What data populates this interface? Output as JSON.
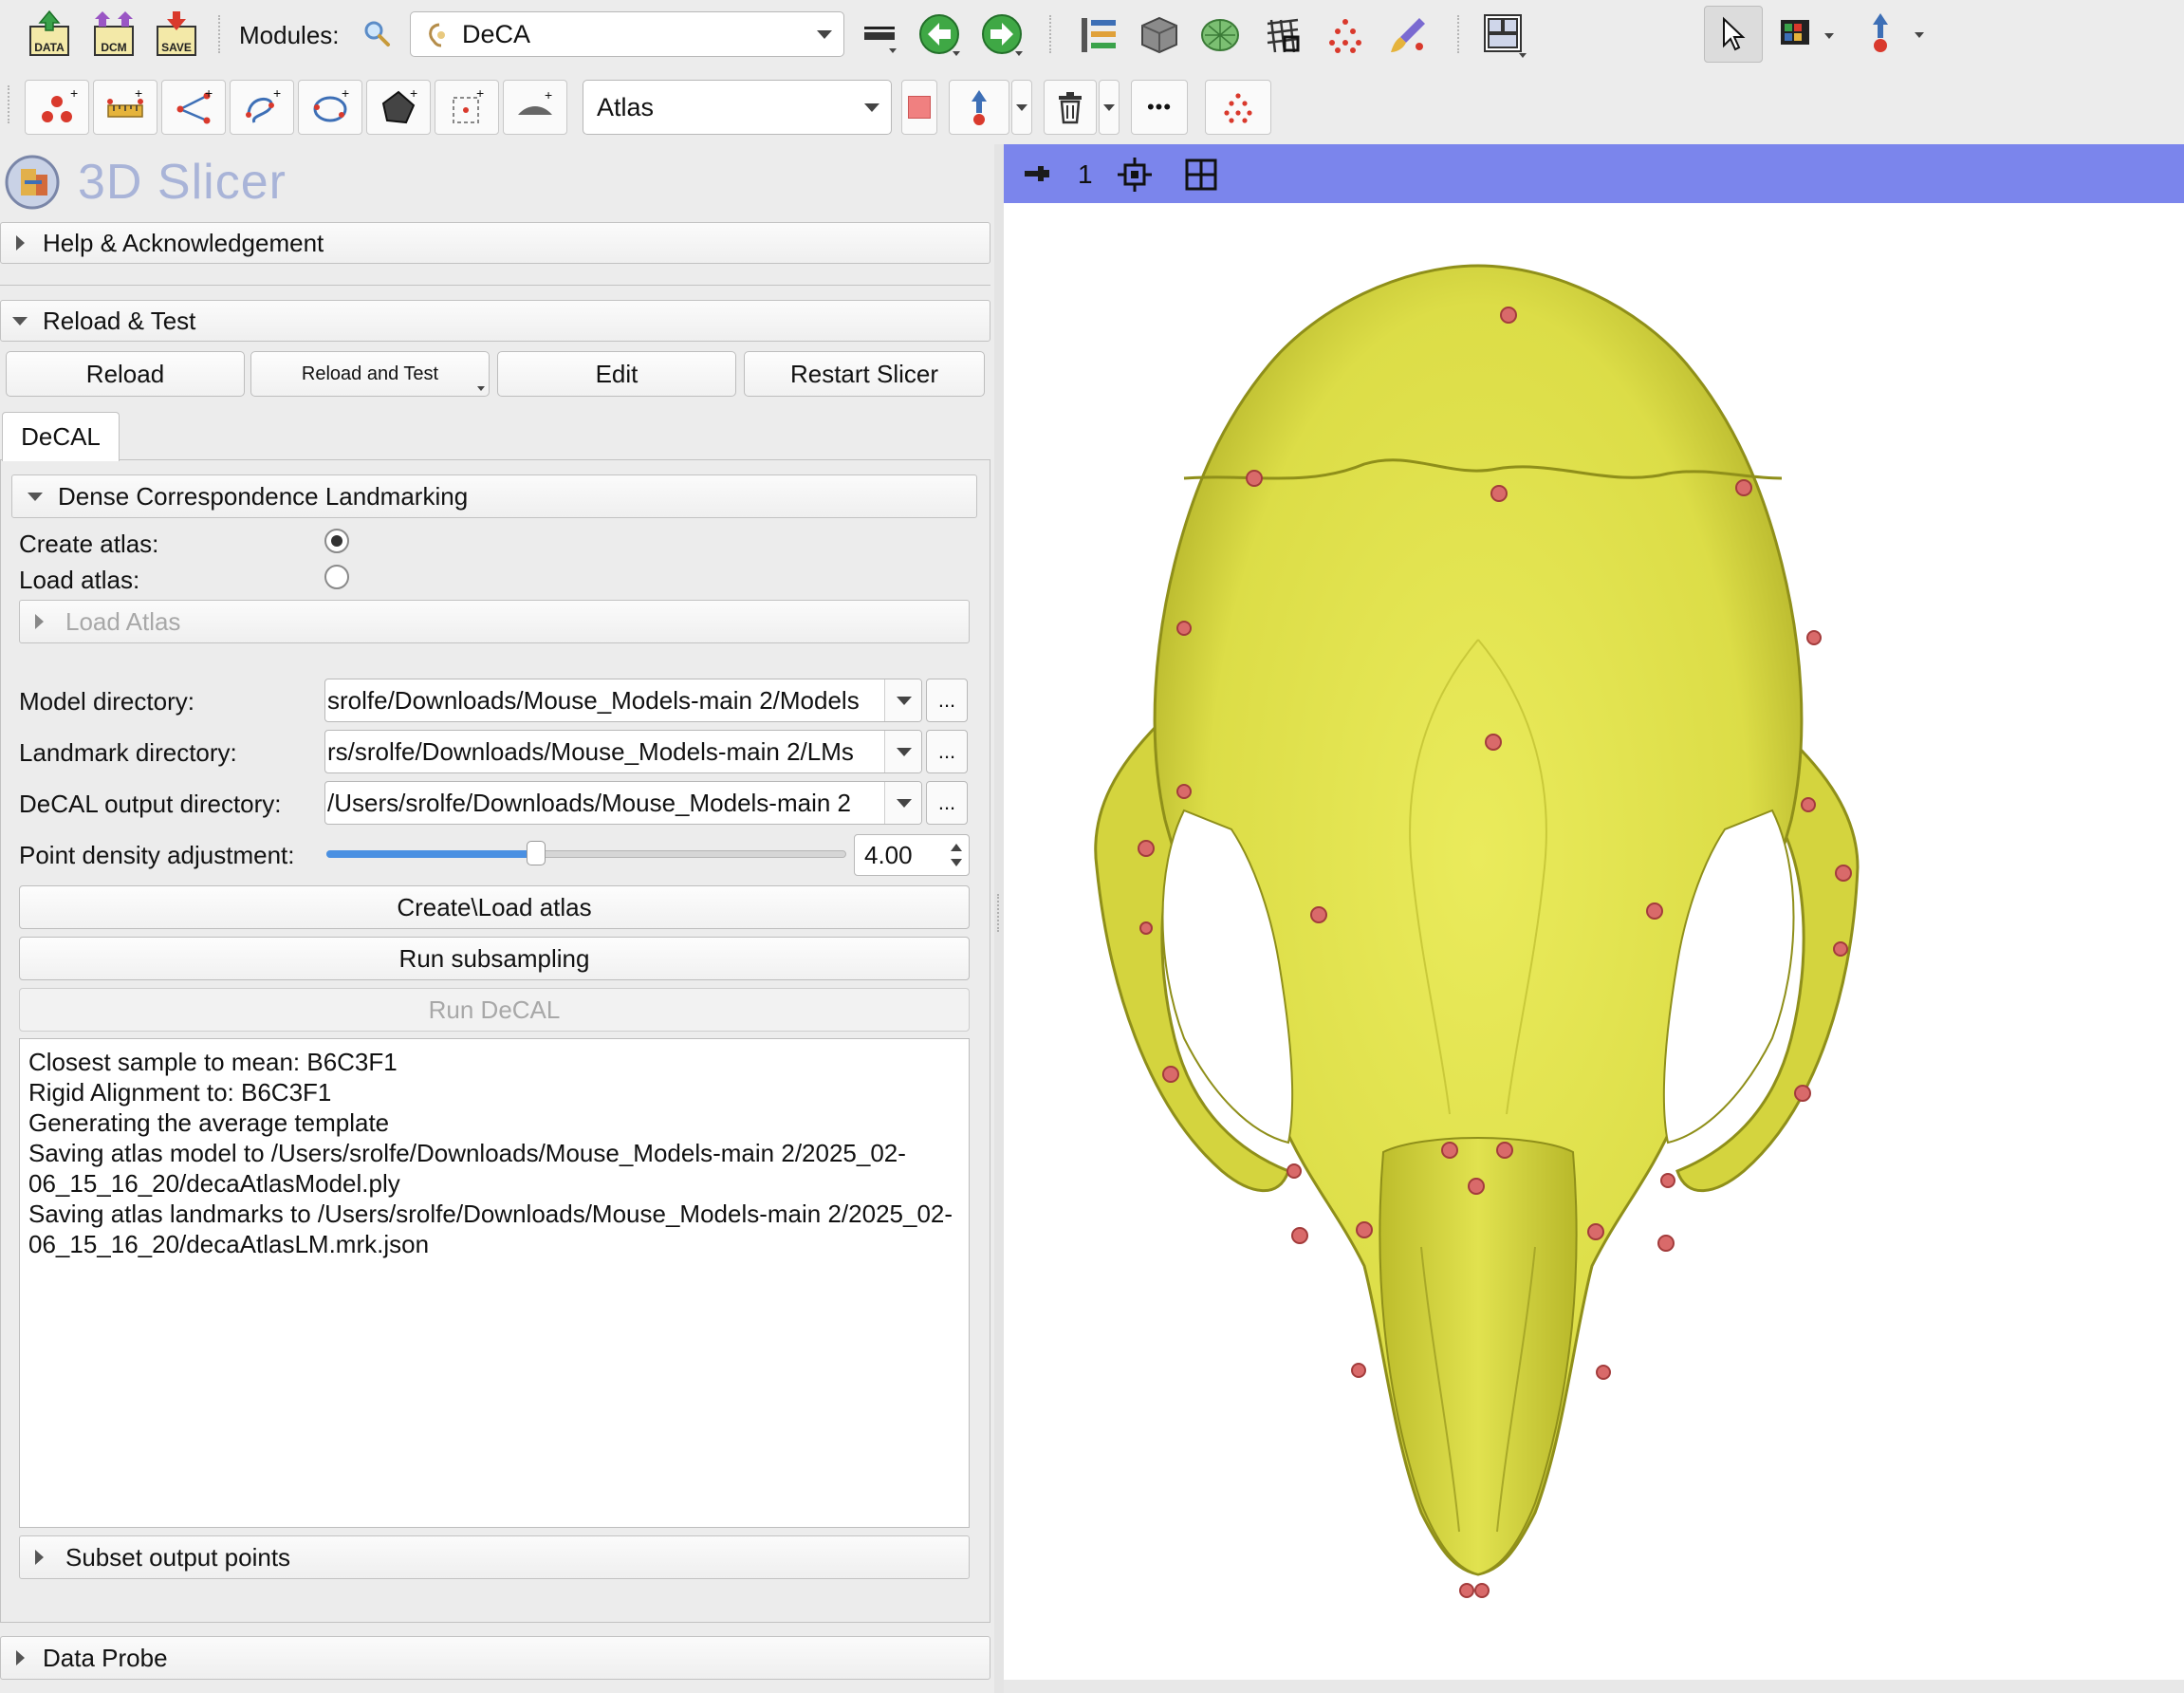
{
  "toolbar": {
    "data_label": "DATA",
    "dcm_label": "DCM",
    "save_label": "SAVE",
    "modules_label": "Modules:",
    "module_selected": "DeCA",
    "markup_node_selected": "Atlas"
  },
  "app": {
    "title": "3D Slicer"
  },
  "panel": {
    "help_section": "Help & Acknowledgement",
    "reload_section": "Reload & Test",
    "reload_buttons": {
      "reload": "Reload",
      "reload_and_test": "Reload and Test",
      "edit": "Edit",
      "restart": "Restart Slicer"
    },
    "tab": "DeCAL",
    "dense_section": "Dense Correspondence Landmarking",
    "create_atlas_label": "Create atlas:",
    "load_atlas_label": "Load atlas:",
    "load_atlas_section": "Load Atlas",
    "model_dir_label": "Model directory:",
    "model_dir_value": "srolfe/Downloads/Mouse_Models-main 2/Models",
    "landmark_dir_label": "Landmark directory:",
    "landmark_dir_value": "rs/srolfe/Downloads/Mouse_Models-main 2/LMs",
    "output_dir_label": "DeCAL output directory:",
    "output_dir_value": "/Users/srolfe/Downloads/Mouse_Models-main 2",
    "browse_label": "...",
    "density_label": "Point density adjustment:",
    "density_value": "4.00",
    "density_fraction": 0.4,
    "create_load_button": "Create\\Load atlas",
    "run_subsampling_button": "Run subsampling",
    "run_decal_button": "Run DeCAL",
    "log_lines": [
      "Closest sample to mean: B6C3F1",
      "Rigid Alignment to: B6C3F1",
      "Generating the average template",
      "Saving atlas model to /Users/srolfe/Downloads/Mouse_Models-main 2/2025_02-06_15_16_20/decaAtlasModel.ply",
      "Saving atlas landmarks to /Users/srolfe/Downloads/Mouse_Models-main 2/2025_02-06_15_16_20/decaAtlasLM.mrk.json"
    ],
    "subset_section": "Subset output points",
    "data_probe_section": "Data Probe"
  },
  "viewer": {
    "view_index": "1",
    "background_color": "#ffffff",
    "bar_color": "#7b85ec",
    "model_color": "#e3e452",
    "landmark_color": "#d96a6a"
  },
  "colors": {
    "accent_blue": "#4a90e2"
  }
}
